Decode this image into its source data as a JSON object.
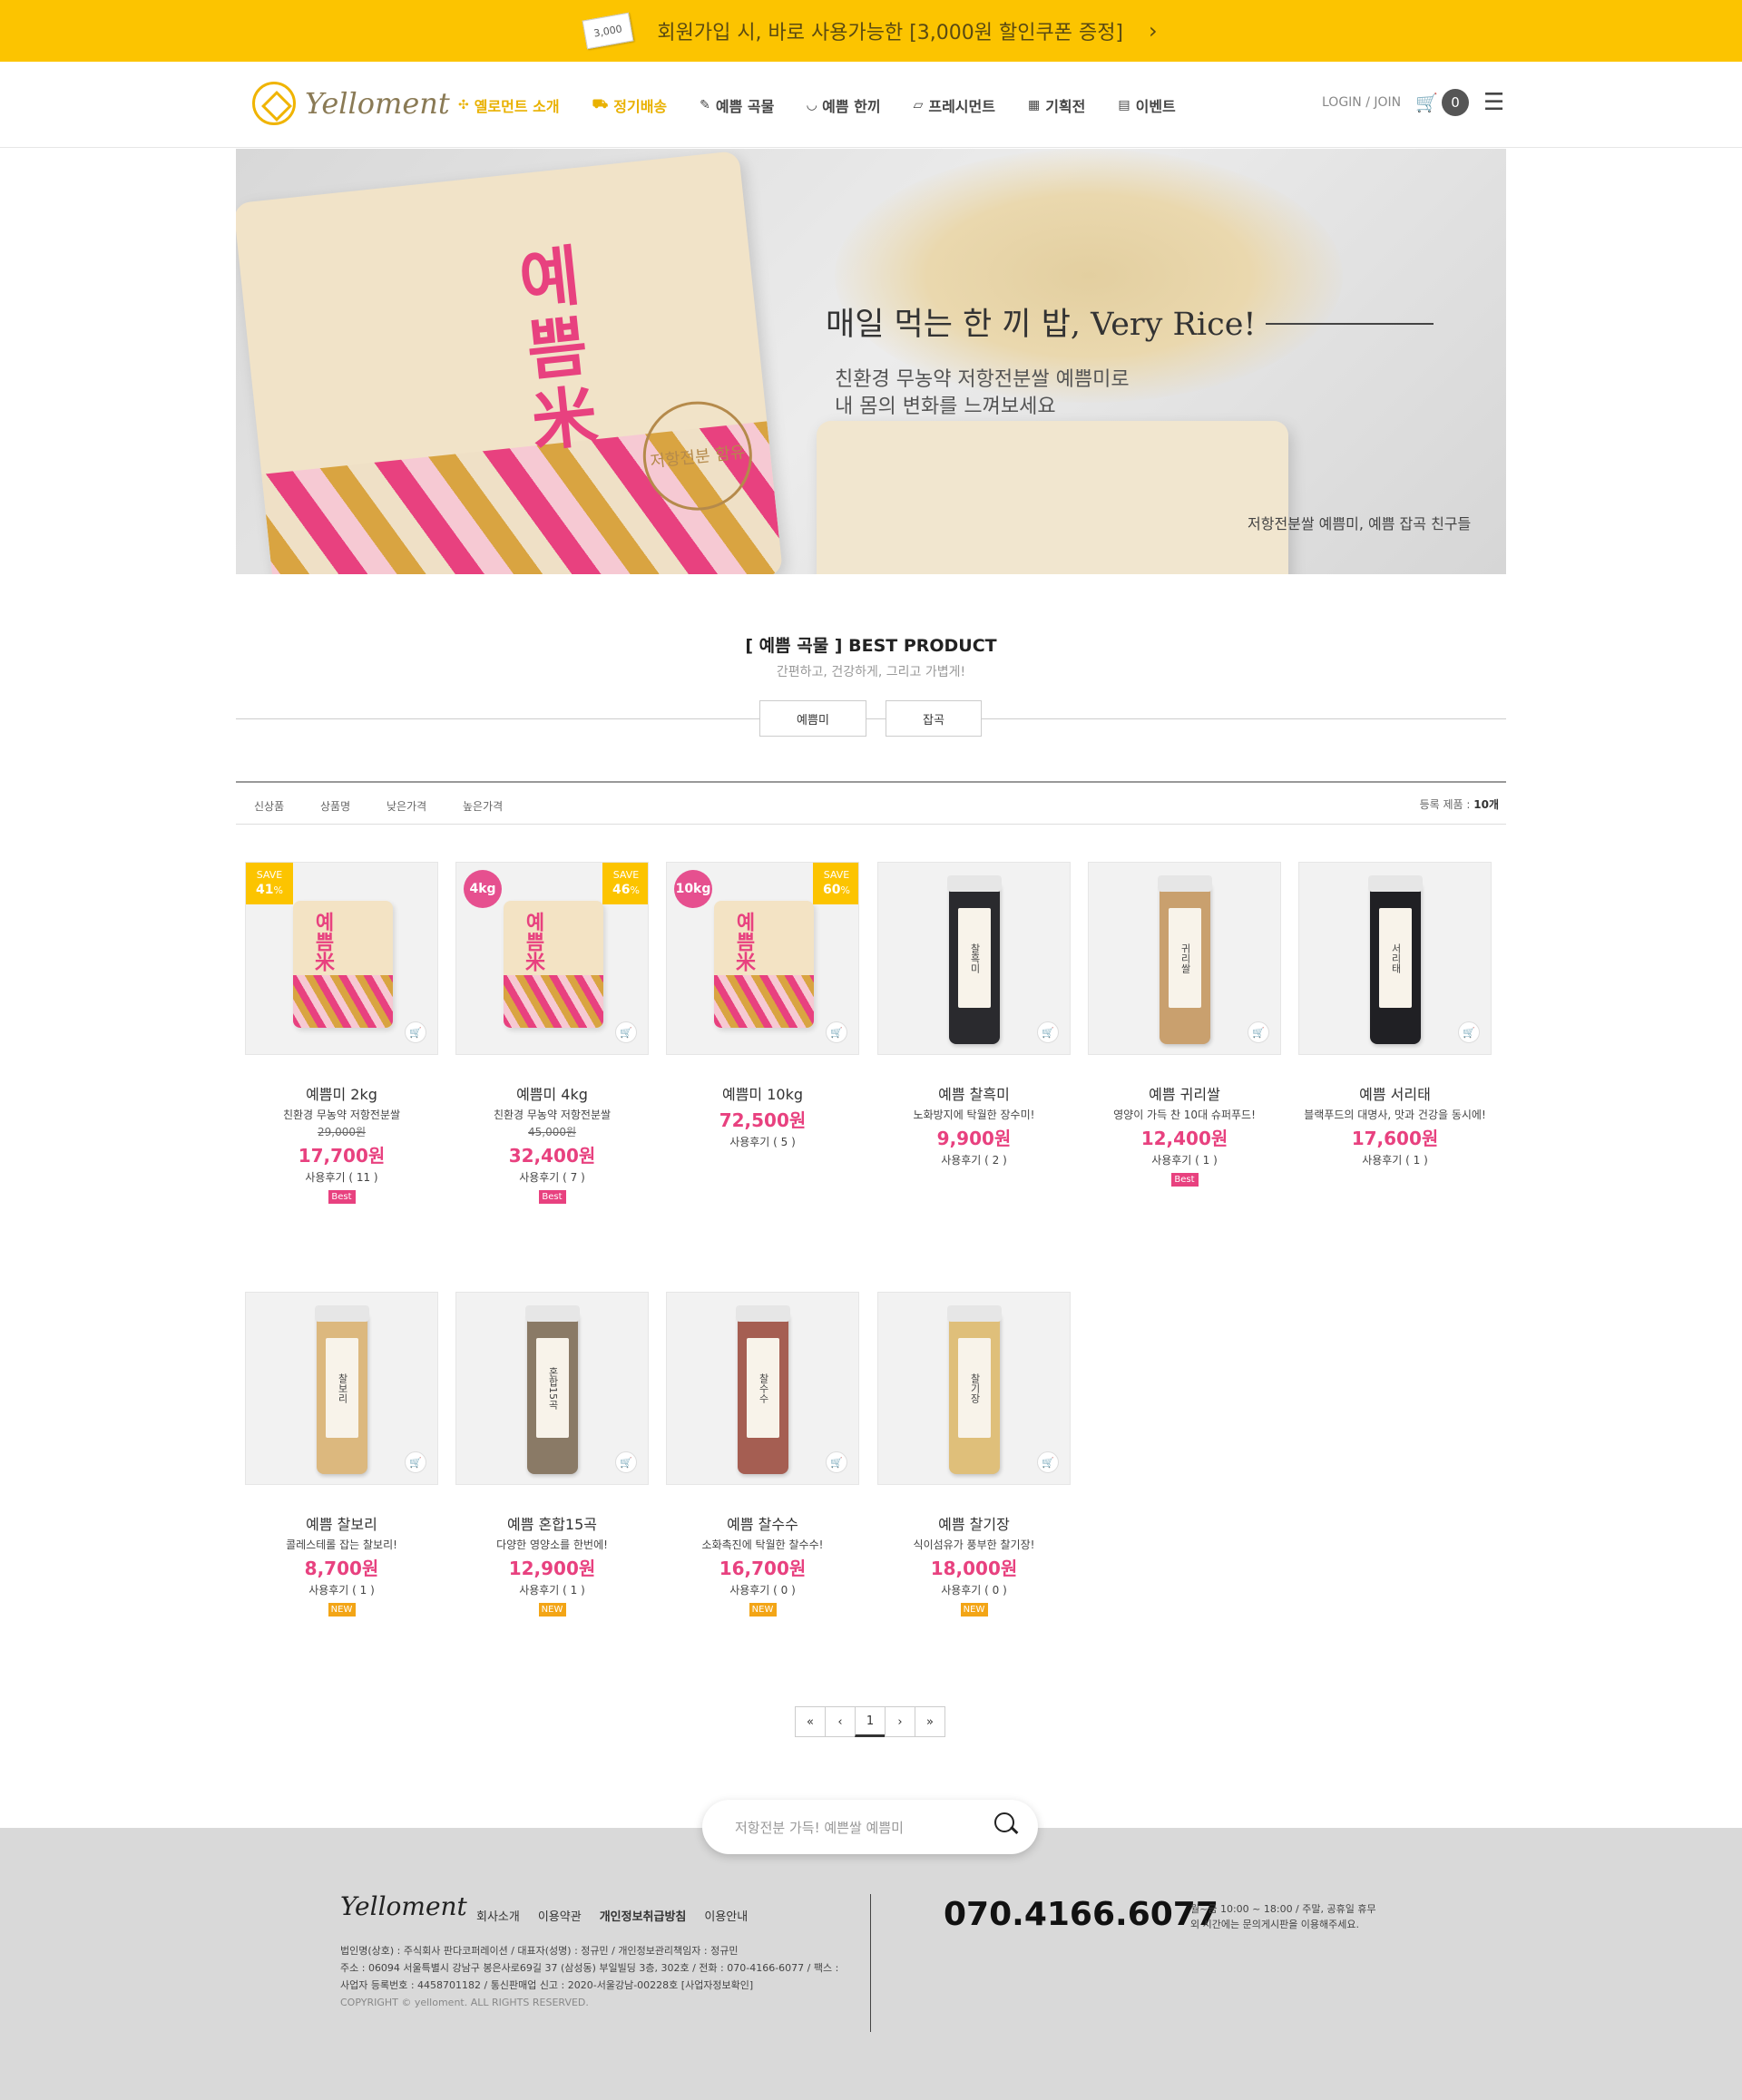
{
  "topbar": {
    "coupon_tag": "3,000",
    "text": "회원가입 시, 바로 사용가능한 [3,000원 할인쿠폰 증정]",
    "arrow": "›"
  },
  "header": {
    "logo": "Yelloment",
    "nav": [
      {
        "icon": "✣",
        "label": "옐로먼트 소개"
      },
      {
        "icon": "⛟",
        "label": "정기배송"
      },
      {
        "icon": "✎",
        "label": "예쁨 곡물"
      },
      {
        "icon": "◡",
        "label": "예쁨 한끼"
      },
      {
        "icon": "▱",
        "label": "프레시먼트"
      },
      {
        "icon": "▦",
        "label": "기획전"
      },
      {
        "icon": "▤",
        "label": "이벤트"
      }
    ],
    "login": "LOGIN / JOIN",
    "cart_count": "0"
  },
  "hero": {
    "bag_title": "예쁨米",
    "bag_seal": "저항전분 함유",
    "title": "매일 먹는 한 끼 밥, Very Rice!",
    "sub1": "친환경 무농약 저항전분쌀 예쁨미로",
    "sub2": "내 몸의 변화를 느껴보세요",
    "caption": "저항전분쌀 예쁨미, 예쁨 잡곡 친구들"
  },
  "section": {
    "title": "[ 예쁨 곡물 ] BEST PRODUCT",
    "subtitle": "간편하고, 건강하게, 그리고 가볍게!",
    "tabs": [
      "예쁨미",
      "잡곡"
    ]
  },
  "sort": {
    "options": [
      "신상품",
      "상품명",
      "낮은가격",
      "높은가격"
    ],
    "count_label": "등록 제품 :",
    "count_value": "10개"
  },
  "products": [
    {
      "name": "예쁨미 2kg",
      "desc": "친환경 무농약 저항전분쌀",
      "old": "29,000원",
      "price": "17,700원",
      "reviews": "사용후기 ( 11 )",
      "tag": "Best",
      "save": "41",
      "img": "bag"
    },
    {
      "name": "예쁨미 4kg",
      "desc": "친환경 무농약 저항전분쌀",
      "old": "45,000원",
      "price": "32,400원",
      "reviews": "사용후기 ( 7 )",
      "tag": "Best",
      "save": "46",
      "kg": "4kg",
      "img": "bag"
    },
    {
      "name": "예쁨미 10kg",
      "price": "72,500원",
      "reviews": "사용후기 ( 5 )",
      "save": "60",
      "kg": "10kg",
      "img": "bag"
    },
    {
      "name": "예쁨 찰흑미",
      "desc": "노화방지에 탁월한 장수미!",
      "price": "9,900원",
      "reviews": "사용후기 ( 2 )",
      "img": "jar",
      "jar_color": "#2a2a2e",
      "jar_label": "찰흑미"
    },
    {
      "name": "예쁨 귀리쌀",
      "desc": "영양이 가득 찬 10대 슈퍼푸드!",
      "price": "12,400원",
      "reviews": "사용후기 ( 1 )",
      "tag": "Best",
      "img": "jar",
      "jar_color": "#c9a06e",
      "jar_label": "귀리쌀"
    },
    {
      "name": "예쁨 서리태",
      "desc": "블랙푸드의 대명사, 맛과 건강을 동시에!",
      "price": "17,600원",
      "reviews": "사용후기 ( 1 )",
      "img": "jar",
      "jar_color": "#202024",
      "jar_label": "서리태"
    },
    {
      "name": "예쁨 찰보리",
      "desc": "콜레스테롤 잡는 찰보리!",
      "price": "8,700원",
      "reviews": "사용후기 ( 1 )",
      "tag": "NEW",
      "img": "jar",
      "jar_color": "#dcb87e",
      "jar_label": "찰보리"
    },
    {
      "name": "예쁨 혼합15곡",
      "desc": "다양한 영양소를 한번에!",
      "price": "12,900원",
      "reviews": "사용후기 ( 1 )",
      "tag": "NEW",
      "img": "jar",
      "jar_color": "#8a7a66",
      "jar_label": "혼합15곡"
    },
    {
      "name": "예쁨 찰수수",
      "desc": "소화촉진에 탁월한 찰수수!",
      "price": "16,700원",
      "reviews": "사용후기 ( 0 )",
      "tag": "NEW",
      "img": "jar",
      "jar_color": "#a55e52",
      "jar_label": "찰수수"
    },
    {
      "name": "예쁨 찰기장",
      "desc": "식이섬유가 풍부한 찰기장!",
      "price": "18,000원",
      "reviews": "사용후기 ( 0 )",
      "tag": "NEW",
      "img": "jar",
      "jar_color": "#dfbf7a",
      "jar_label": "찰기장"
    }
  ],
  "pagination": [
    "«",
    "‹",
    "1",
    "›",
    "»"
  ],
  "search": {
    "placeholder": "저항전분 가득! 예쁜쌀 예쁨미"
  },
  "footer": {
    "logo": "Yelloment",
    "links": [
      "회사소개",
      "이용약관",
      "개인정보취급방침",
      "이용안내"
    ],
    "info1": "법인명(상호) : 주식회사 판다코퍼레이션 / 대표자(성명) : 정규민 / 개인정보관리책임자 : 정규민",
    "info2": "주소 : 06094 서울특별시 강남구 봉은사로69길 37 (삼성동) 부일빌딩 3층, 302호 / 전화 : 070-4166-6077 / 팩스 :",
    "info3": "사업자 등록번호 : 4458701182 / 통신판매업 신고 : 2020-서울강남-00228호 [사업자정보확인]",
    "copyright": "COPYRIGHT © yelloment. ALL RIGHTS RESERVED.",
    "phone": "070.4166.6077",
    "hours1": "월~금 10:00 ~ 18:00 / 주말, 공휴일 휴무",
    "hours2": "외 시간에는 문의게시판을 이용해주세요."
  }
}
